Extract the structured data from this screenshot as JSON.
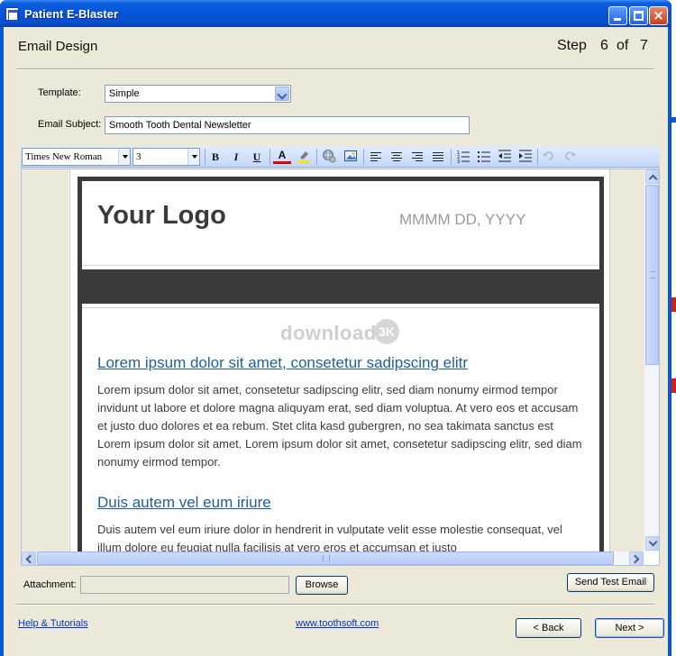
{
  "window": {
    "title": "Patient E-Blaster",
    "close_glyph": "×"
  },
  "header": {
    "title": "Email Design",
    "step_word": "Step",
    "step_current": "6",
    "step_of": "of",
    "step_total": "7"
  },
  "form": {
    "template_label": "Template:",
    "template_value": "Simple",
    "subject_label": "Email Subject:",
    "subject_value": "Smooth Tooth Dental Newsletter"
  },
  "toolbar": {
    "font_name": "Times New Roman",
    "font_size": "3",
    "bold": "B",
    "italic": "I",
    "underline": "U",
    "font_color_letter": "A",
    "icons": [
      "bold-icon",
      "italic-icon",
      "underline-icon",
      "font-color-icon",
      "highlight-icon",
      "insert-link-icon",
      "insert-image-icon",
      "align-left-icon",
      "align-center-icon",
      "align-right-icon",
      "justify-icon",
      "numbered-list-icon",
      "bullet-list-icon",
      "outdent-icon",
      "indent-icon",
      "undo-icon",
      "redo-icon"
    ]
  },
  "newsletter": {
    "logo": "Your Logo",
    "date": "MMMM DD, YYYY",
    "watermark": "download",
    "watermark_badge": "3K",
    "articles": [
      {
        "heading": "Lorem ipsum dolor sit amet, consetetur sadipscing elitr",
        "body": "Lorem ipsum dolor sit amet, consetetur sadipscing elitr, sed diam nonumy eirmod tempor invidunt ut labore et dolore magna aliquyam erat, sed diam voluptua. At vero eos et accusam et justo duo dolores et ea rebum. Stet clita kasd gubergren, no sea takimata sanctus est Lorem ipsum dolor sit amet. Lorem ipsum dolor sit amet, consetetur sadipscing elitr, sed diam nonumy eirmod tempor."
      },
      {
        "heading": "Duis autem vel eum iriure",
        "body": "Duis autem vel eum iriure dolor in hendrerit in vulputate velit esse molestie consequat, vel illum dolore eu feugiat nulla facilisis at vero eros et accumsan et iusto"
      }
    ]
  },
  "bottom": {
    "attachment_label": "Attachment:",
    "attachment_value": "",
    "browse_label": "Browse",
    "send_test_label": "Send Test Email",
    "help_link": "Help & Tutorials",
    "site_link": "www.toothsoft.com",
    "back_label": "< Back",
    "next_label": "Next >"
  },
  "colors": {
    "titlebar": "#0553d6",
    "dialog_bg": "#ece9d8",
    "newsletter_dark": "#3b3b3b",
    "heading_link": "#1f5f97",
    "hyperlink": "#0033cc"
  }
}
